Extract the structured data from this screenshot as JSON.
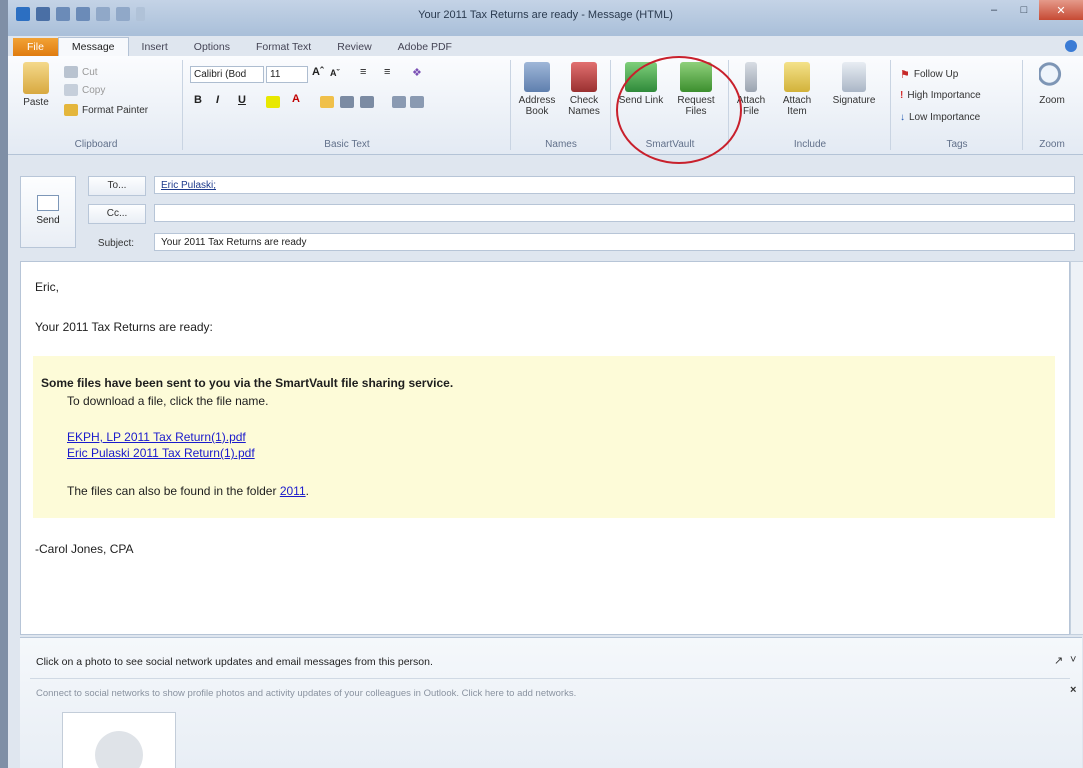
{
  "window": {
    "title": "Your 2011 Tax Returns are ready - Message (HTML)"
  },
  "tabs": [
    "File",
    "Message",
    "Insert",
    "Options",
    "Format Text",
    "Review",
    "Adobe PDF"
  ],
  "ribbon": {
    "clipboard": {
      "paste": "Paste",
      "cut": "Cut",
      "copy": "Copy",
      "format_painter": "Format Painter",
      "label": "Clipboard"
    },
    "basic_text": {
      "font": "Calibri (Bod",
      "size": "11",
      "bold": "B",
      "italic": "I",
      "underline": "U",
      "label": "Basic Text"
    },
    "names": {
      "address_book": "Address Book",
      "check_names": "Check Names",
      "label": "Names"
    },
    "smartvault": {
      "send_link": "Send Link",
      "request_files": "Request Files",
      "label": "SmartVault"
    },
    "include": {
      "attach_file": "Attach File",
      "attach_item": "Attach Item",
      "signature": "Signature",
      "label": "Include"
    },
    "tags": {
      "follow_up": "Follow Up",
      "high_importance": "High Importance",
      "low_importance": "Low Importance",
      "label": "Tags"
    },
    "zoom": {
      "zoom": "Zoom",
      "label": "Zoom"
    }
  },
  "compose": {
    "send_label": "Send",
    "to_button": "To...",
    "cc_button": "Cc...",
    "subject_label": "Subject:",
    "to_value": "Eric Pulaski;",
    "cc_value": "",
    "subject_value": "Your 2011 Tax Returns are ready"
  },
  "body": {
    "greeting": "Eric,",
    "line1": "Your 2011 Tax Returns are ready:",
    "notice_heading": "Some files have been sent to you via the SmartVault file sharing service.",
    "notice_instruction": "To download a file, click the file name.",
    "file1": "EKPH, LP 2011 Tax Return(1).pdf",
    "file2": "Eric Pulaski 2011 Tax Return(1).pdf",
    "folder_text": "The files can also be found in the folder",
    "folder_link": "2011",
    "signature": "-Carol Jones, CPA"
  },
  "people_pane": {
    "line1": "Click on a photo to see social network updates and email messages from this person.",
    "line2": "Connect to social networks to show profile photos and activity updates of your colleagues in Outlook. Click here to add networks."
  },
  "colors": {
    "file_tab": "#e07c10",
    "highlight_circle": "#c8202c",
    "notice_bg": "#fdfbd8",
    "link": "#1a1acc"
  }
}
